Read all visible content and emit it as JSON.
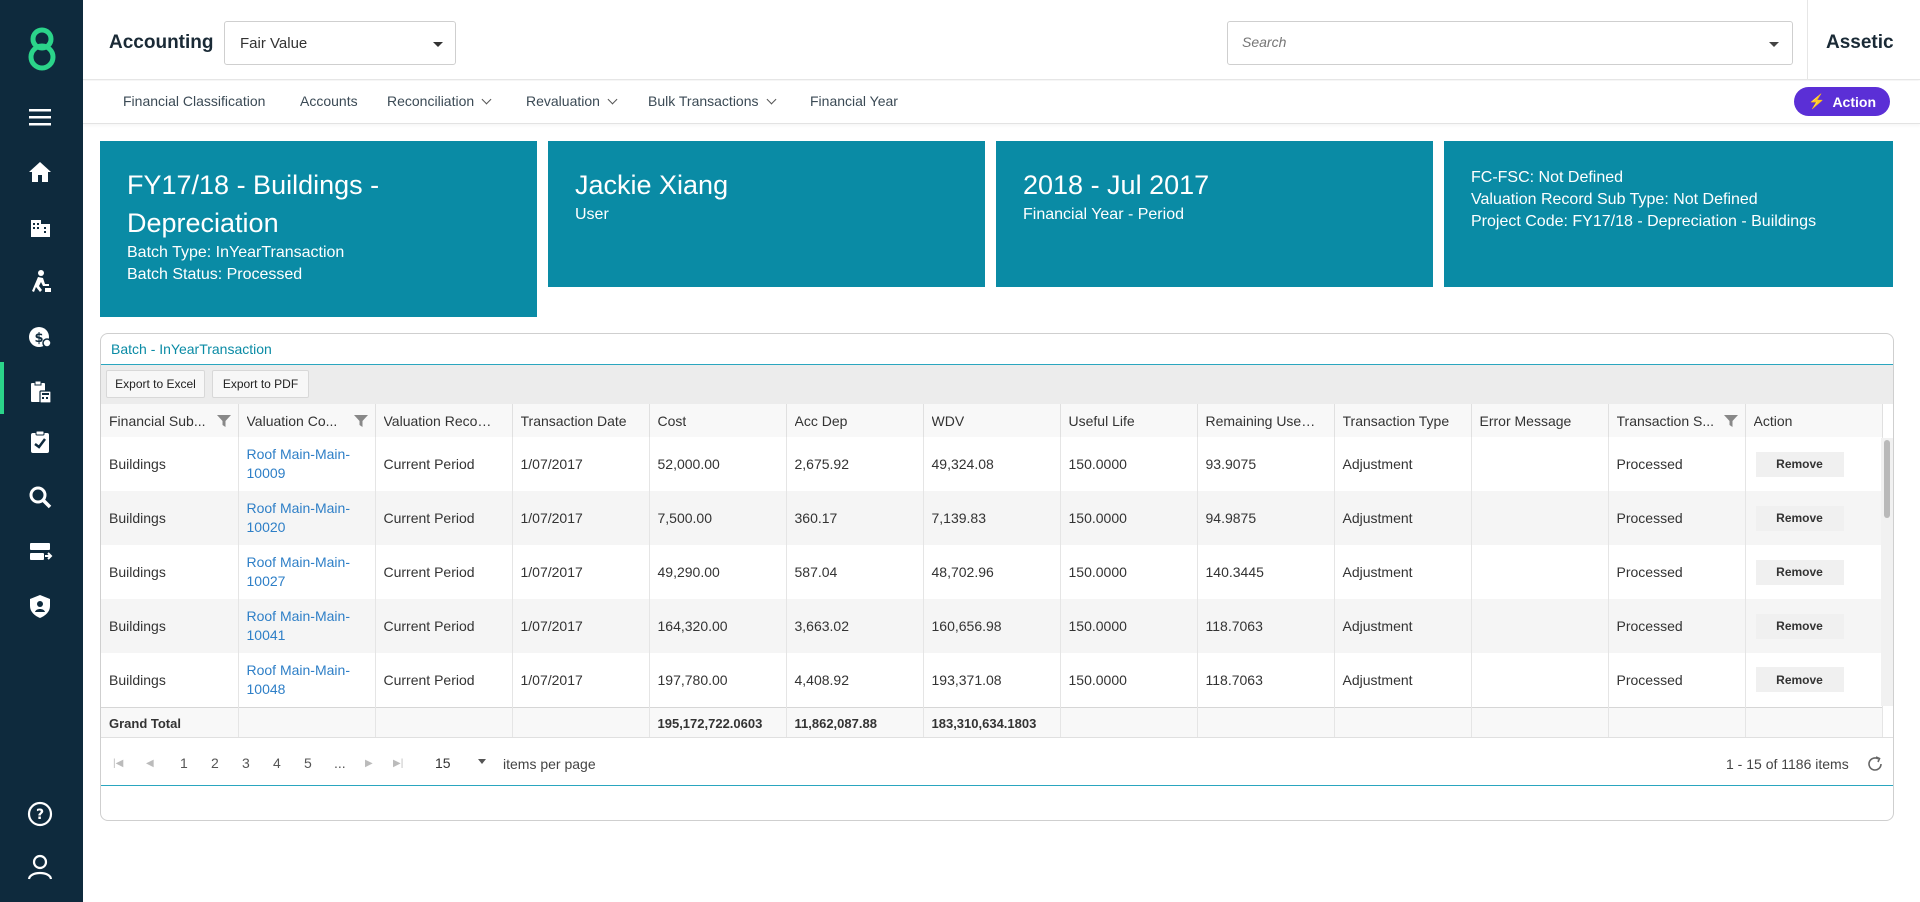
{
  "app": {
    "module_title": "Accounting",
    "module_select": "Fair Value",
    "search_placeholder": "Search",
    "brand": "Assetic",
    "action_label": "Action"
  },
  "nav_icons": [
    "logo-icon",
    "menu-icon",
    "home-icon",
    "building-icon",
    "worker-icon",
    "finance-icon",
    "accounting-icon",
    "checklist-icon",
    "search-icon",
    "workflow-icon",
    "security-icon",
    "help-icon",
    "user-icon"
  ],
  "subnav": {
    "financial_classification": "Financial Classification",
    "accounts": "Accounts",
    "reconciliation": "Reconciliation",
    "revaluation": "Revaluation",
    "bulk_transactions": "Bulk Transactions",
    "financial_year": "Financial Year"
  },
  "cards": {
    "batch": {
      "title": "FY17/18 - Buildings - Depreciation",
      "batch_type": "Batch Type: InYearTransaction",
      "batch_status": "Batch Status: Processed"
    },
    "user": {
      "name": "Jackie Xiang",
      "label": "User"
    },
    "period": {
      "value": "2018 - Jul 2017",
      "label": "Financial Year - Period"
    },
    "details": {
      "fc_fsc": "FC-FSC: Not Defined",
      "sub_type": "Valuation Record Sub Type: Not Defined",
      "project_code": "Project Code: FY17/18 - Depreciation - Buildings"
    }
  },
  "grid": {
    "title": "Batch - InYearTransaction",
    "export_excel": "Export to Excel",
    "export_pdf": "Export to PDF",
    "columns": [
      "Financial Sub...",
      "Valuation Co...",
      "Valuation Record ...",
      "Transaction Date",
      "Cost",
      "Acc Dep",
      "WDV",
      "Useful Life",
      "Remaining Useful ...",
      "Transaction Type",
      "Error Message",
      "Transaction S...",
      "Action"
    ],
    "rows": [
      {
        "sub": "Buildings",
        "comp1": "Roof Main-Main-",
        "comp2": "10009",
        "record": "Current Period",
        "date": "1/07/2017",
        "cost": "52,000.00",
        "accdep": "2,675.92",
        "wdv": "49,324.08",
        "life": "150.0000",
        "remaining": "93.9075",
        "type": "Adjustment",
        "error": "",
        "status": "Processed",
        "action": "Remove"
      },
      {
        "sub": "Buildings",
        "comp1": "Roof Main-Main-",
        "comp2": "10020",
        "record": "Current Period",
        "date": "1/07/2017",
        "cost": "7,500.00",
        "accdep": "360.17",
        "wdv": "7,139.83",
        "life": "150.0000",
        "remaining": "94.9875",
        "type": "Adjustment",
        "error": "",
        "status": "Processed",
        "action": "Remove"
      },
      {
        "sub": "Buildings",
        "comp1": "Roof Main-Main-",
        "comp2": "10027",
        "record": "Current Period",
        "date": "1/07/2017",
        "cost": "49,290.00",
        "accdep": "587.04",
        "wdv": "48,702.96",
        "life": "150.0000",
        "remaining": "140.3445",
        "type": "Adjustment",
        "error": "",
        "status": "Processed",
        "action": "Remove"
      },
      {
        "sub": "Buildings",
        "comp1": "Roof Main-Main-",
        "comp2": "10041",
        "record": "Current Period",
        "date": "1/07/2017",
        "cost": "164,320.00",
        "accdep": "3,663.02",
        "wdv": "160,656.98",
        "life": "150.0000",
        "remaining": "118.7063",
        "type": "Adjustment",
        "error": "",
        "status": "Processed",
        "action": "Remove"
      },
      {
        "sub": "Buildings",
        "comp1": "Roof Main-Main-",
        "comp2": "10048",
        "record": "Current Period",
        "date": "1/07/2017",
        "cost": "197,780.00",
        "accdep": "4,408.92",
        "wdv": "193,371.08",
        "life": "150.0000",
        "remaining": "118.7063",
        "type": "Adjustment",
        "error": "",
        "status": "Processed",
        "action": "Remove"
      }
    ],
    "total": {
      "label": "Grand Total",
      "cost": "195,172,722.0603",
      "accdep": "11,862,087.88",
      "wdv": "183,310,634.1803"
    }
  },
  "pager": {
    "pages": [
      "1",
      "2",
      "3",
      "4",
      "5",
      "..."
    ],
    "per_page": "15",
    "per_page_label": "items per page",
    "summary": "1 - 15 of 1186 items"
  },
  "colors": {
    "rail": "#0e2a3d",
    "card": "#0a8ba5",
    "action": "#5b2fd6",
    "link": "#2e7fc7",
    "accent": "#2bd48a"
  }
}
